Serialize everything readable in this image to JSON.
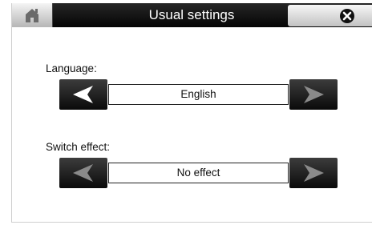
{
  "header": {
    "title": "Usual settings",
    "home_icon": "home-icon",
    "close_icon": "close-circle-icon"
  },
  "settings": [
    {
      "label": "Language:",
      "value": "English",
      "prev_enabled": true,
      "next_enabled": true
    },
    {
      "label": "Switch effect:",
      "value": "No effect",
      "prev_enabled": false,
      "next_enabled": true
    }
  ],
  "colors": {
    "titlebar": "#111111",
    "button_dark": "#1a1a1a",
    "arrow_enabled": "#ffffff",
    "arrow_disabled": "#8a8a8a"
  }
}
